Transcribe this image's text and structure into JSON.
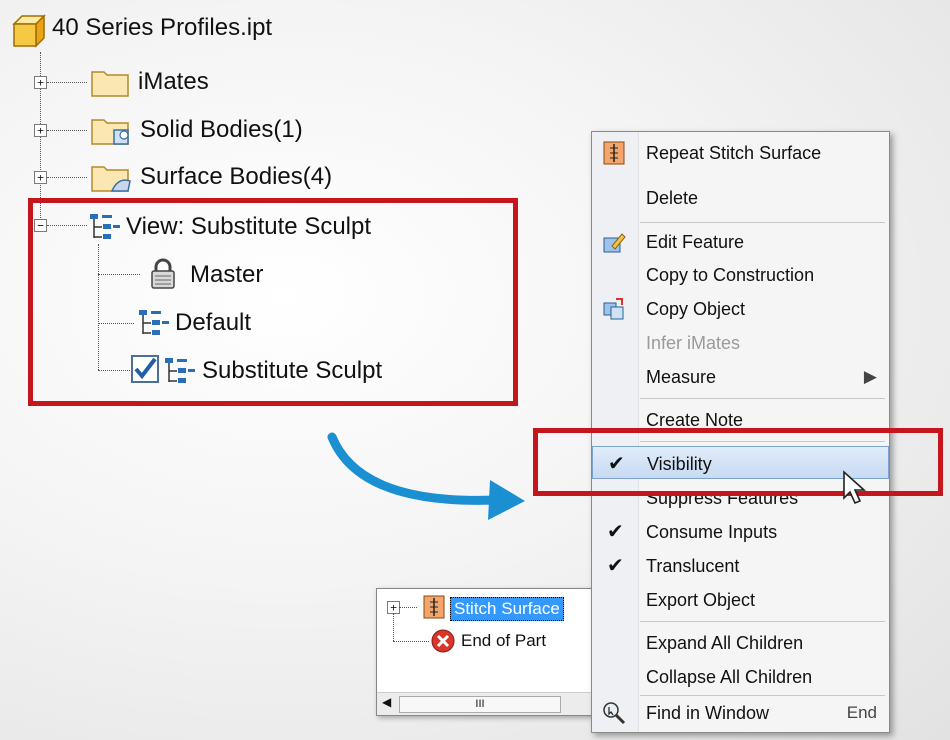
{
  "browser": {
    "root": "40 Series Profiles.ipt",
    "items": [
      {
        "label": "iMates",
        "expand": "+"
      },
      {
        "label": "Solid Bodies(1)",
        "expand": "+"
      },
      {
        "label": "Surface Bodies(4)",
        "expand": "+"
      }
    ],
    "view": {
      "label": "View: Substitute Sculpt",
      "expand": "−",
      "children": [
        {
          "label": "Master"
        },
        {
          "label": "Default"
        },
        {
          "label": "Substitute Sculpt",
          "checked": true
        }
      ]
    }
  },
  "context_menu": {
    "items": [
      {
        "label": "Repeat Stitch Surface",
        "icon": "stitch-icon"
      },
      {
        "label": "Delete"
      },
      {
        "label": "Edit Feature",
        "icon": "edit-feature-icon"
      },
      {
        "label": "Copy to Construction"
      },
      {
        "label": "Copy Object",
        "icon": "copy-object-icon"
      },
      {
        "label": "Infer iMates",
        "disabled": true
      },
      {
        "label": "Measure",
        "submenu": "▶"
      },
      {
        "label": "Create Note"
      },
      {
        "label": "Visibility",
        "checked": true,
        "selected": true
      },
      {
        "label": "Suppress Features"
      },
      {
        "label": "Consume Inputs",
        "checked": true
      },
      {
        "label": "Translucent",
        "checked": true
      },
      {
        "label": "Export Object"
      },
      {
        "label": "Expand All Children"
      },
      {
        "label": "Collapse All Children"
      },
      {
        "label": "Find in Window",
        "icon": "find-in-window-icon",
        "shortcut": "End"
      }
    ]
  },
  "mini_browser": {
    "items": [
      {
        "label": "Stitch Surface",
        "expand": "+",
        "selected": true
      },
      {
        "label": "End of Part"
      }
    ],
    "scroll_thumb": "III"
  },
  "check_mark": "✔",
  "colors": {
    "highlight_red": "#c4161c",
    "arrow_blue": "#1a8fd1",
    "selection_blue": "#3399ff",
    "menu_hover": "#c7daf2"
  }
}
